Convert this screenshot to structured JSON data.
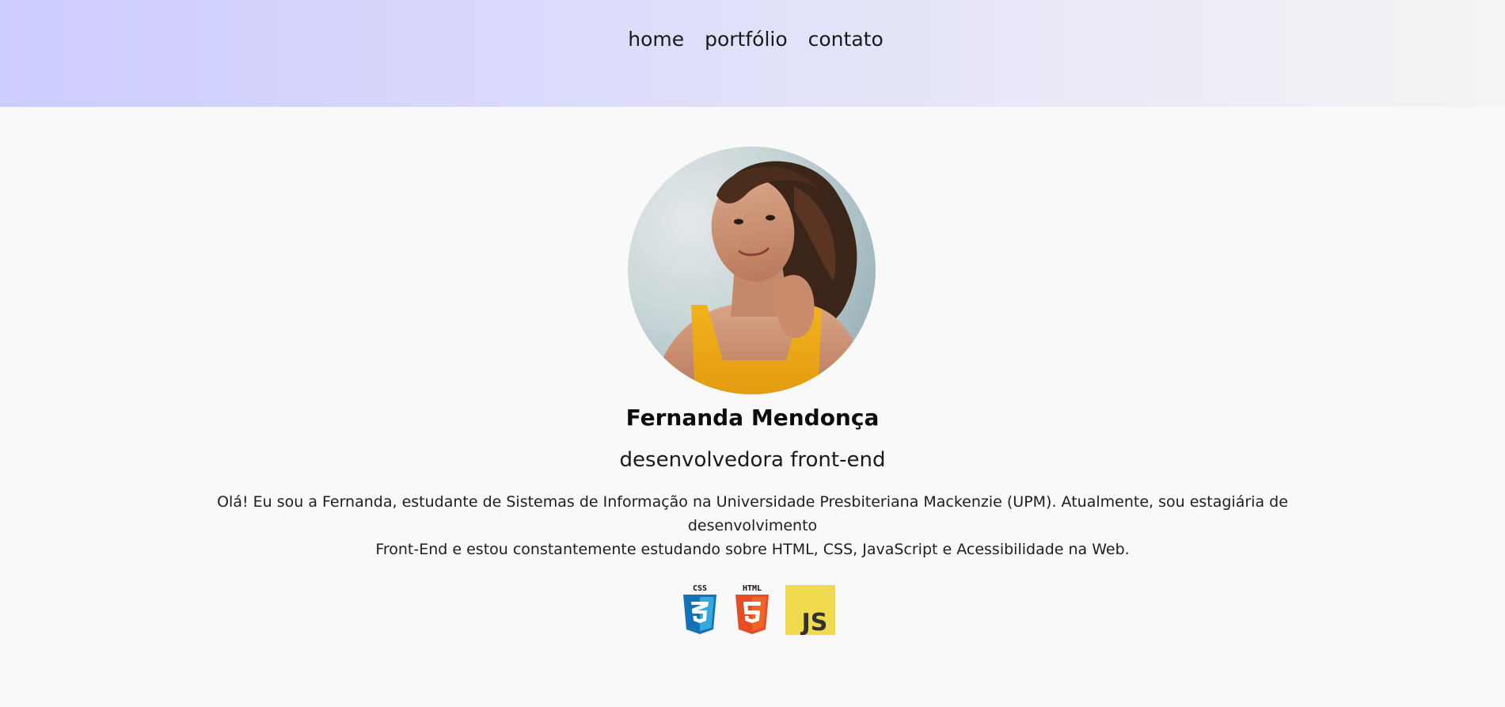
{
  "nav": {
    "items": [
      {
        "label": "home"
      },
      {
        "label": "portfólio"
      },
      {
        "label": "contato"
      }
    ]
  },
  "profile": {
    "name": "Fernanda Mendonça",
    "role": "desenvolvedora front-end",
    "bio_line1": "Olá! Eu sou a Fernanda, estudante de Sistemas de Informação na Universidade Presbiteriana Mackenzie (UPM). Atualmente, sou estagiária de desenvolvimento",
    "bio_line2": "Front-End e estou constantemente estudando sobre HTML, CSS, JavaScript e Acessibilidade na Web."
  },
  "tech_icons": [
    {
      "name": "css3-icon",
      "label": "CSS",
      "color": "#1572b6"
    },
    {
      "name": "html5-icon",
      "label": "HTML",
      "color": "#e44d26"
    },
    {
      "name": "javascript-icon",
      "label": "JS",
      "color": "#f0db4f"
    }
  ],
  "colors": {
    "header_start": "#cdccff",
    "header_end": "#f4f4f4",
    "background": "#f9f9f9"
  }
}
